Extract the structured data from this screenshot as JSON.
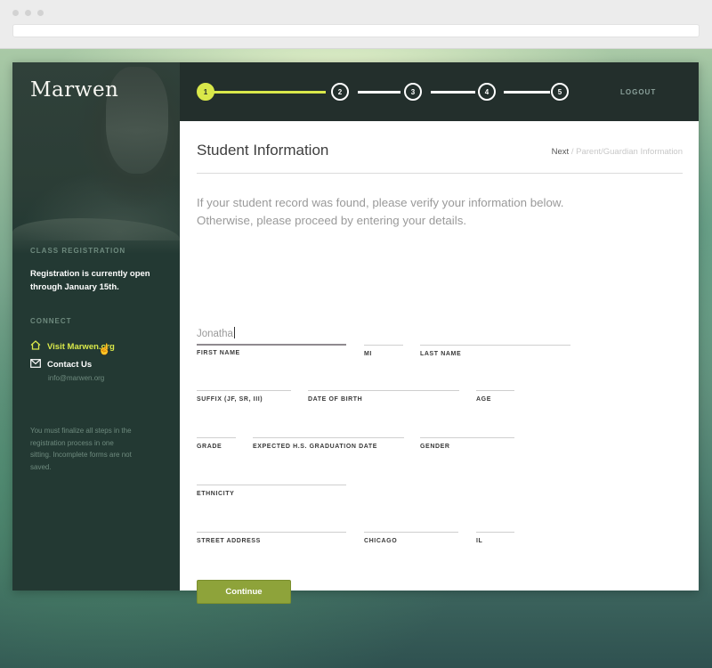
{
  "brand": {
    "logo_text": "Marwen"
  },
  "sidebar": {
    "class_registration_heading": "CLASS REGISTRATION",
    "registration_text": "Registration is currently open through January 15th.",
    "connect_heading": "CONNECT",
    "visit_link": "Visit Marwen.org",
    "contact_link": "Contact Us",
    "email": "info@marwen.org",
    "note": "You must finalize all steps in the registration process in one sitting. Incomplete forms are not saved."
  },
  "progress": {
    "steps": [
      "1",
      "2",
      "3",
      "4",
      "5"
    ],
    "current_step": 1,
    "logout_label": "LOGOUT",
    "accent_color": "#d9e84a"
  },
  "page": {
    "title": "Student Information",
    "next_label": "Next",
    "next_target": "/ Parent/Guardian Information",
    "intro": "If your student record was found, please verify your information below. Otherwise, please proceed by entering your details."
  },
  "form": {
    "first_name": {
      "label": "FIRST NAME",
      "value": "Jonatha"
    },
    "mi": {
      "label": "MI",
      "value": ""
    },
    "last_name": {
      "label": "LAST NAME",
      "value": ""
    },
    "suffix": {
      "label": "SUFFIX (JF, SR, III)",
      "value": ""
    },
    "dob": {
      "label": "DATE OF BIRTH",
      "value": ""
    },
    "age": {
      "label": "AGE",
      "value": ""
    },
    "grade": {
      "label": "GRADE",
      "value": ""
    },
    "grad_date": {
      "label": "EXPECTED H.S. GRADUATION DATE",
      "value": ""
    },
    "gender": {
      "label": "GENDER",
      "value": ""
    },
    "ethnicity": {
      "label": "ETHNICITY",
      "value": ""
    },
    "street": {
      "label": "STREET ADDRESS",
      "value": ""
    },
    "city": {
      "label": "CHICAGO",
      "value": ""
    },
    "state": {
      "label": "IL",
      "value": ""
    },
    "continue_label": "Continue",
    "button_color": "#8ea33a"
  }
}
